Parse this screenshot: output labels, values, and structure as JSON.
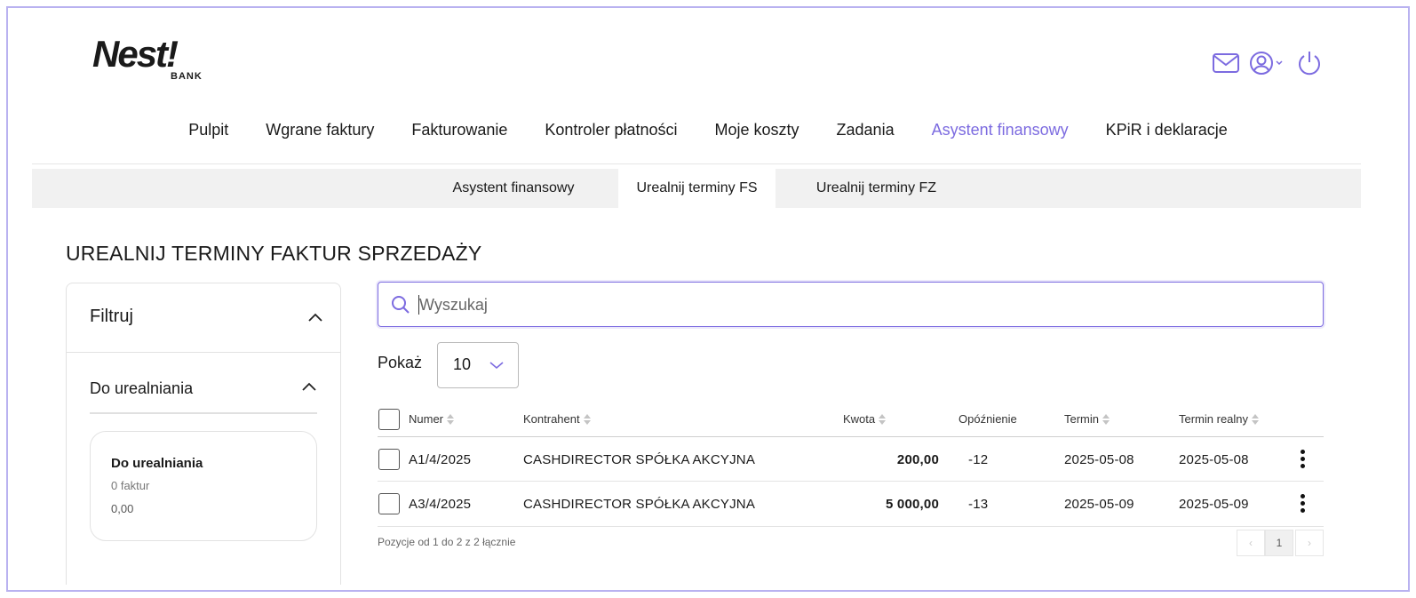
{
  "brand": {
    "logo_text": "Nest!",
    "logo_sub": "BANK",
    "accent": "#7c6be0"
  },
  "header_icons": [
    "mail-icon",
    "user-icon",
    "power-icon"
  ],
  "main_nav": [
    {
      "label": "Pulpit",
      "active": false
    },
    {
      "label": "Wgrane faktury",
      "active": false
    },
    {
      "label": "Fakturowanie",
      "active": false
    },
    {
      "label": "Kontroler płatności",
      "active": false
    },
    {
      "label": "Moje koszty",
      "active": false
    },
    {
      "label": "Zadania",
      "active": false
    },
    {
      "label": "Asystent finansowy",
      "active": true
    },
    {
      "label": "KPiR i deklaracje",
      "active": false
    }
  ],
  "sub_nav": [
    {
      "label": "Asystent finansowy",
      "active": false
    },
    {
      "label": "Urealnij terminy FS",
      "active": true
    },
    {
      "label": "Urealnij terminy FZ",
      "active": false
    }
  ],
  "page_title": "UREALNIJ TERMINY FAKTUR SPRZEDAŻY",
  "filter": {
    "title": "Filtruj",
    "section_title": "Do urealniania",
    "card": {
      "title": "Do urealniania",
      "count": "0 faktur",
      "amount": "0,00"
    }
  },
  "search": {
    "placeholder": "Wyszukaj",
    "value": ""
  },
  "page_size": {
    "label": "Pokaż",
    "value": "10"
  },
  "table": {
    "headers": {
      "numer": "Numer",
      "kontrahent": "Kontrahent",
      "kwota": "Kwota",
      "opoznienie": "Opóźnienie",
      "termin": "Termin",
      "termin_realny": "Termin realny"
    },
    "rows": [
      {
        "numer": "A1/4/2025",
        "kontrahent": "CASHDIRECTOR SPÓŁKA AKCYJNA",
        "kwota": "200,00",
        "opoznienie": "-12",
        "termin": "2025-05-08",
        "termin_realny": "2025-05-08"
      },
      {
        "numer": "A3/4/2025",
        "kontrahent": "CASHDIRECTOR SPÓŁKA AKCYJNA",
        "kwota": "5 000,00",
        "opoznienie": "-13",
        "termin": "2025-05-09",
        "termin_realny": "2025-05-09"
      }
    ]
  },
  "pagination": {
    "info": "Pozycje od 1 do 2 z 2 łącznie",
    "prev": "‹",
    "current": "1",
    "next": "›"
  }
}
